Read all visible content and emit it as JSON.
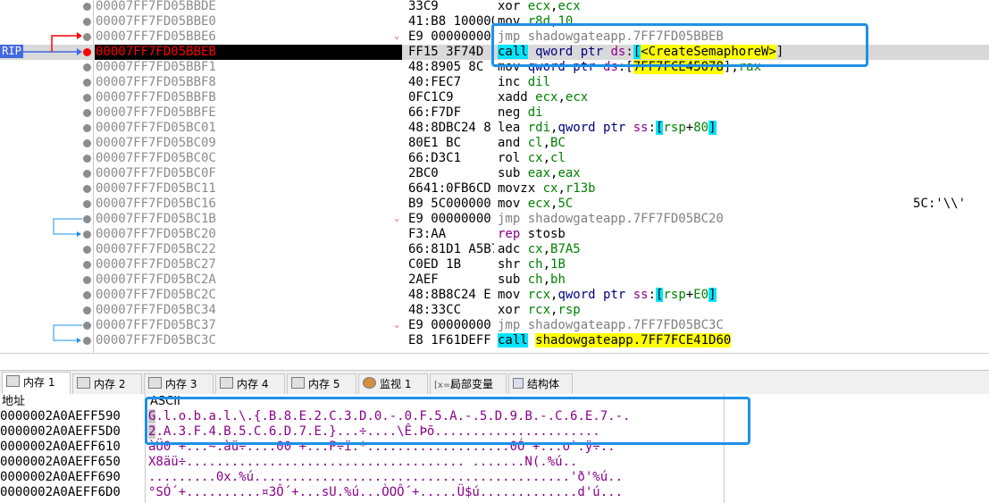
{
  "disasm": {
    "rip_label": "RIP",
    "rows": [
      {
        "addr": "00007FF7FD05BBDE",
        "bytes": "33C9",
        "fold": "",
        "instr": [
          [
            "m",
            "xor "
          ],
          [
            "r",
            "ecx"
          ],
          [
            "n",
            ","
          ],
          [
            "r",
            "ecx"
          ]
        ],
        "cmt": ""
      },
      {
        "addr": "00007FF7FD05BBE0",
        "bytes": "41:B8 1000000",
        "fold": "",
        "instr": [
          [
            "m",
            "mov "
          ],
          [
            "r",
            "r8d"
          ],
          [
            "n",
            ","
          ],
          [
            "r",
            "10"
          ]
        ],
        "cmt": ""
      },
      {
        "addr": "00007FF7FD05BBE6",
        "bytes": "E9 00000000",
        "fold": "⌄",
        "instr": [
          [
            "mj",
            "jmp shadowgateapp.7FF7FD05BBEB"
          ]
        ],
        "cmt": ""
      },
      {
        "addr": "00007FF7FD05BBEB",
        "bytes": "FF15 3F74D",
        "fold": "",
        "instr": [
          [
            "mc",
            "call"
          ],
          [
            "k",
            " qword "
          ],
          [
            "k",
            "ptr "
          ],
          [
            "seg",
            "ds"
          ],
          [
            "n",
            ":"
          ],
          [
            "br",
            "["
          ],
          [
            "yl",
            "<CreateSemaphoreW>"
          ],
          [
            "n",
            "]"
          ]
        ],
        "cmt": ""
      },
      {
        "addr": "00007FF7FD05BBF1",
        "bytes": "48:8905 8C",
        "fold": "",
        "instr": [
          [
            "m",
            "mov "
          ],
          [
            "k",
            "qword "
          ],
          [
            "k",
            "ptr "
          ],
          [
            "seg",
            "ds"
          ],
          [
            "n",
            ":["
          ],
          [
            "yl",
            "7FF7FCE45078"
          ],
          [
            "n",
            "],"
          ],
          [
            "r",
            "rax"
          ]
        ],
        "cmt": ""
      },
      {
        "addr": "00007FF7FD05BBF8",
        "bytes": "40:FEC7",
        "fold": "",
        "instr": [
          [
            "m",
            "inc "
          ],
          [
            "r",
            "dil"
          ]
        ],
        "cmt": ""
      },
      {
        "addr": "00007FF7FD05BBFB",
        "bytes": "0FC1C9",
        "fold": "",
        "instr": [
          [
            "m",
            "xadd "
          ],
          [
            "r",
            "ecx"
          ],
          [
            "n",
            ","
          ],
          [
            "r",
            "ecx"
          ]
        ],
        "cmt": ""
      },
      {
        "addr": "00007FF7FD05BBFE",
        "bytes": "66:F7DF",
        "fold": "",
        "instr": [
          [
            "m",
            "neg "
          ],
          [
            "r",
            "di"
          ]
        ],
        "cmt": ""
      },
      {
        "addr": "00007FF7FD05BC01",
        "bytes": "48:8DBC24 8",
        "fold": "",
        "instr": [
          [
            "m",
            "lea "
          ],
          [
            "r",
            "rdi"
          ],
          [
            "n",
            ","
          ],
          [
            "k",
            "qword "
          ],
          [
            "k",
            "ptr "
          ],
          [
            "seg",
            "ss"
          ],
          [
            "n",
            ":"
          ],
          [
            "br",
            "["
          ],
          [
            "r",
            "rsp"
          ],
          [
            "n",
            "+"
          ],
          [
            "r",
            "80"
          ],
          [
            "br",
            "]"
          ]
        ],
        "cmt": ""
      },
      {
        "addr": "00007FF7FD05BC09",
        "bytes": "80E1 BC",
        "fold": "",
        "instr": [
          [
            "m",
            "and "
          ],
          [
            "r",
            "cl"
          ],
          [
            "n",
            ","
          ],
          [
            "r",
            "BC"
          ]
        ],
        "cmt": ""
      },
      {
        "addr": "00007FF7FD05BC0C",
        "bytes": "66:D3C1",
        "fold": "",
        "instr": [
          [
            "m",
            "rol "
          ],
          [
            "r",
            "cx"
          ],
          [
            "n",
            ","
          ],
          [
            "r",
            "cl"
          ]
        ],
        "cmt": ""
      },
      {
        "addr": "00007FF7FD05BC0F",
        "bytes": "2BC0",
        "fold": "",
        "instr": [
          [
            "m",
            "sub "
          ],
          [
            "r",
            "eax"
          ],
          [
            "n",
            ","
          ],
          [
            "r",
            "eax"
          ]
        ],
        "cmt": ""
      },
      {
        "addr": "00007FF7FD05BC11",
        "bytes": "6641:0FB6CD",
        "fold": "",
        "instr": [
          [
            "m",
            "movzx "
          ],
          [
            "r",
            "cx"
          ],
          [
            "n",
            ","
          ],
          [
            "r",
            "r13b"
          ]
        ],
        "cmt": ""
      },
      {
        "addr": "00007FF7FD05BC16",
        "bytes": "B9 5C000000",
        "fold": "",
        "instr": [
          [
            "m",
            "mov "
          ],
          [
            "r",
            "ecx"
          ],
          [
            "n",
            ","
          ],
          [
            "r",
            "5C"
          ]
        ],
        "cmt": "5C:'\\\\'"
      },
      {
        "addr": "00007FF7FD05BC1B",
        "bytes": "E9 00000000",
        "fold": "⌄",
        "instr": [
          [
            "mj",
            "jmp shadowgateapp.7FF7FD05BC20"
          ]
        ],
        "cmt": ""
      },
      {
        "addr": "00007FF7FD05BC20",
        "bytes": "F3:AA",
        "fold": "",
        "instr": [
          [
            "pf",
            "rep "
          ],
          [
            "m",
            "stosb"
          ]
        ],
        "cmt": ""
      },
      {
        "addr": "00007FF7FD05BC22",
        "bytes": "66:81D1 A5B7",
        "fold": "",
        "instr": [
          [
            "m",
            "adc "
          ],
          [
            "r",
            "cx"
          ],
          [
            "n",
            ","
          ],
          [
            "r",
            "B7A5"
          ]
        ],
        "cmt": ""
      },
      {
        "addr": "00007FF7FD05BC27",
        "bytes": "C0ED 1B",
        "fold": "",
        "instr": [
          [
            "m",
            "shr "
          ],
          [
            "r",
            "ch"
          ],
          [
            "n",
            ","
          ],
          [
            "r",
            "1B"
          ]
        ],
        "cmt": ""
      },
      {
        "addr": "00007FF7FD05BC2A",
        "bytes": "2AEF",
        "fold": "",
        "instr": [
          [
            "m",
            "sub "
          ],
          [
            "r",
            "ch"
          ],
          [
            "n",
            ","
          ],
          [
            "r",
            "bh"
          ]
        ],
        "cmt": ""
      },
      {
        "addr": "00007FF7FD05BC2C",
        "bytes": "48:8B8C24 E",
        "fold": "",
        "instr": [
          [
            "m",
            "mov "
          ],
          [
            "r",
            "rcx"
          ],
          [
            "n",
            ","
          ],
          [
            "k",
            "qword "
          ],
          [
            "k",
            "ptr "
          ],
          [
            "seg",
            "ss"
          ],
          [
            "n",
            ":"
          ],
          [
            "br",
            "["
          ],
          [
            "r",
            "rsp"
          ],
          [
            "n",
            "+"
          ],
          [
            "r",
            "E0"
          ],
          [
            "br",
            "]"
          ]
        ],
        "cmt": ""
      },
      {
        "addr": "00007FF7FD05BC34",
        "bytes": "48:33CC",
        "fold": "",
        "instr": [
          [
            "m",
            "xor "
          ],
          [
            "r",
            "rcx"
          ],
          [
            "n",
            ","
          ],
          [
            "r",
            "rsp"
          ]
        ],
        "cmt": ""
      },
      {
        "addr": "00007FF7FD05BC37",
        "bytes": "E9 00000000",
        "fold": "⌄",
        "instr": [
          [
            "mj",
            "jmp shadowgateapp.7FF7FD05BC3C"
          ]
        ],
        "cmt": ""
      },
      {
        "addr": "00007FF7FD05BC3C",
        "bytes": "E8 1F61DEFF",
        "fold": "",
        "instr": [
          [
            "mc",
            "call"
          ],
          [
            "n",
            " "
          ],
          [
            "yl",
            "shadowgateapp.7FF7FCE41D60"
          ]
        ],
        "cmt": ""
      }
    ]
  },
  "tabs": [
    {
      "label": "内存 1",
      "icon": "memory-icon"
    },
    {
      "label": "内存 2",
      "icon": "memory-icon"
    },
    {
      "label": "内存 3",
      "icon": "memory-icon"
    },
    {
      "label": "内存 4",
      "icon": "memory-icon"
    },
    {
      "label": "内存 5",
      "icon": "memory-icon"
    },
    {
      "label": "监视 1",
      "icon": "watch-icon"
    },
    {
      "label": "局部变量",
      "icon": "locals-icon",
      "prefix": "[x=]"
    },
    {
      "label": "结构体",
      "icon": "struct-icon"
    }
  ],
  "dump": {
    "col_addr": "地址",
    "col_ascii": "ASCII",
    "rows": [
      {
        "addr": "0000002A0AEFF590",
        "ascii": "G.l.o.b.a.l.\\.{.B.8.E.2.C.3.D.0.-.0.F.5.A.-.5.D.9.B.-.C.6.E.7.-.",
        "hi": true
      },
      {
        "addr": "0000002A0AEFF5D0",
        "ascii": "2.A.3.F.4.B.5.C.6.D.7.E.}...÷....\\Ê.Þõ......................",
        "hi": true
      },
      {
        "addr": "0000002A0AEFF610",
        "ascii": "àÜ0 +...~.àü÷....00 +...P÷ï.*...................0Ó +...o˙.ÿ÷..",
        "hi": false
      },
      {
        "addr": "0000002A0AEFF650",
        "ascii": "X8äü÷..................................... .......N(.%ú..",
        "hi": false
      },
      {
        "addr": "0000002A0AEFF690",
        "ascii": ".........0x.%ú..........................................'ð'%ú..",
        "hi": false
      },
      {
        "addr": "0000002A0AEFF6D0",
        "ascii": "°SÓ´+..........¤3Ô´+...sU.%ú...ÒOÔ´+.....Ü$ú.............d'ú...",
        "hi": false
      }
    ]
  }
}
